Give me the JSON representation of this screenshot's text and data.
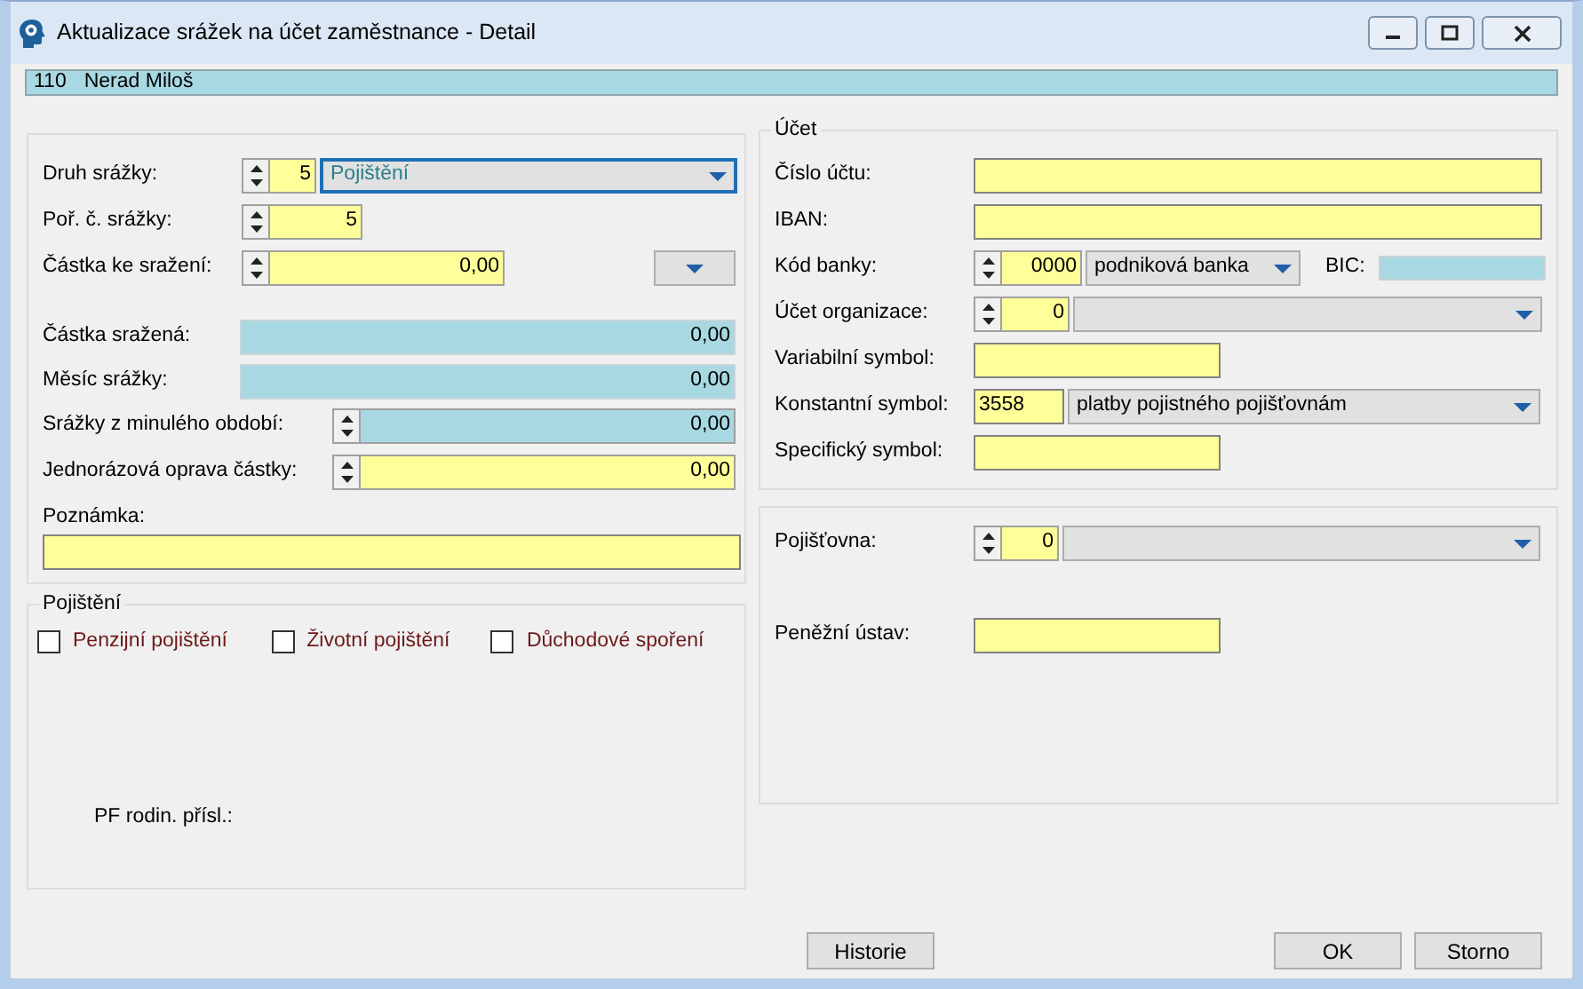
{
  "window": {
    "title": "Aktualizace srážek na účet zaměstnance - Detail"
  },
  "employee": {
    "number": "110",
    "name": "Nerad Miloš"
  },
  "deduction": {
    "rows": [
      {
        "kind": "spinner_combo",
        "label": "Druh srážky:",
        "value": "5",
        "option": "Pojištění",
        "focused": true
      },
      {
        "kind": "spinner",
        "label": "Poř. č. srážky:",
        "value": "5",
        "readonly": false
      },
      {
        "kind": "spinner_button",
        "label": "Částka ke sražení:",
        "value": "0,00",
        "readonly": false
      },
      {
        "kind": "field",
        "label": "Částka sražená:",
        "value": "0,00",
        "readonly": true
      },
      {
        "kind": "field",
        "label": "Měsíc srážky:",
        "value": "0,00",
        "readonly": true
      },
      {
        "kind": "spinner",
        "label": "Srážky z minulého období:",
        "value": "0,00",
        "readonly": true
      },
      {
        "kind": "spinner",
        "label": "Jednorázová oprava částky:",
        "value": "0,00",
        "readonly": false
      },
      {
        "kind": "note",
        "label": "Poznámka:",
        "readonly": false
      }
    ]
  },
  "insurance": {
    "legend": "Pojištění",
    "checkboxes": [
      {
        "label": "Penzijní pojištění",
        "checked": false
      },
      {
        "label": "Životní pojištění",
        "checked": false
      },
      {
        "label": "Důchodové spoření",
        "checked": false
      }
    ],
    "family_label": "PF rodin. přísl.:"
  },
  "account": {
    "legend": "Účet",
    "rows": [
      {
        "kind": "field",
        "label": "Číslo účtu:",
        "readonly": false
      },
      {
        "kind": "field",
        "label": "IBAN:",
        "readonly": false
      },
      {
        "kind": "spinner_combo",
        "label": "Kód banky:",
        "value": "0000",
        "option": "podniková banka",
        "focused": false,
        "extra_label": "BIC:",
        "extra_readonly": true
      },
      {
        "kind": "spinner_combo",
        "label": "Účet organizace:",
        "value": "0",
        "focused": false
      },
      {
        "kind": "field",
        "label": "Variabilní symbol:",
        "readonly": false
      },
      {
        "kind": "field_combo",
        "label": "Konstantní symbol:",
        "value": "3558",
        "option": "platby pojistného pojišťovnám"
      },
      {
        "kind": "field",
        "label": "Specifický symbol:",
        "readonly": false
      }
    ]
  },
  "institution": {
    "rows": [
      {
        "kind": "spinner_combo",
        "label": "Pojišťovna:",
        "value": "0",
        "focused": false
      },
      {
        "kind": "field",
        "label": "Peněžní ústav:",
        "readonly": false
      }
    ]
  },
  "buttons": [
    {
      "label": "Historie"
    },
    {
      "label": "OK"
    },
    {
      "label": "Storno"
    }
  ]
}
